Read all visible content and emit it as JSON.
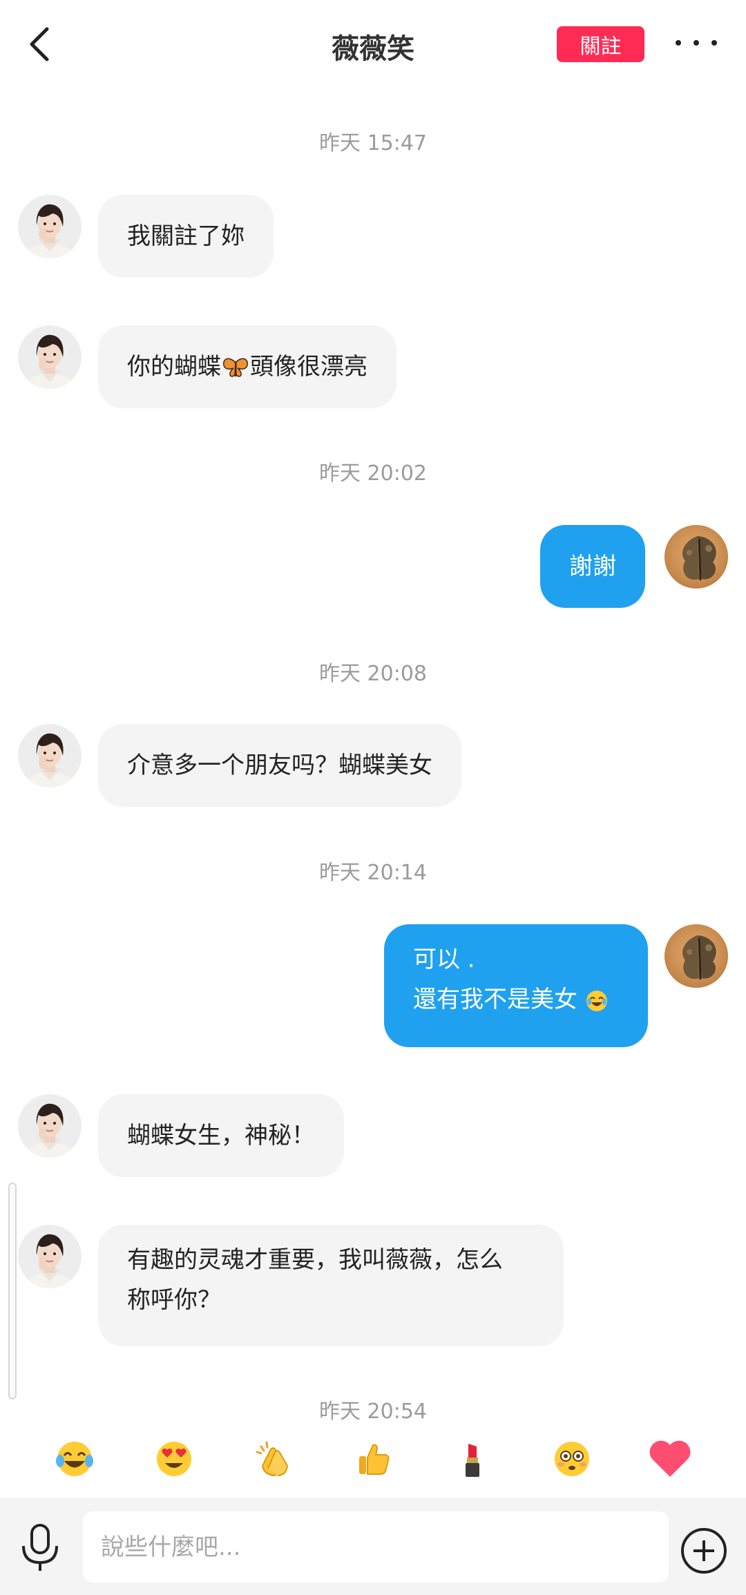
{
  "header": {
    "title": "薇薇笑",
    "follow_label": "關註"
  },
  "messages": {
    "t1": "昨天 15:47",
    "m1": "我關註了妳",
    "m2_pre": "你的蝴蝶",
    "m2_post": "頭像很漂亮",
    "t2": "昨天 20:02",
    "m3": "謝謝",
    "t3": "昨天 20:08",
    "m4": "介意多一个朋友吗？蝴蝶美女",
    "t4": "昨天 20:14",
    "m5_line1": "可以 .",
    "m5_line2": "還有我不是美女",
    "m6": "蝴蝶女生，神秘！",
    "m7_line1": "有趣的灵魂才重要，我叫薇薇，怎么",
    "m7_line2": "称呼你？",
    "t5": "昨天 20:54"
  },
  "quick_emojis": [
    "joy-emoji",
    "heart-eyes-emoji",
    "clap-emoji",
    "thumbs-up-emoji",
    "lipstick-emoji",
    "flushed-emoji",
    "heart-emoji"
  ],
  "input": {
    "placeholder": "說些什麼吧..."
  },
  "colors": {
    "follow": "#fe2c55",
    "outgoing_bubble": "#1fa1ef",
    "incoming_bubble": "#f4f4f4"
  }
}
